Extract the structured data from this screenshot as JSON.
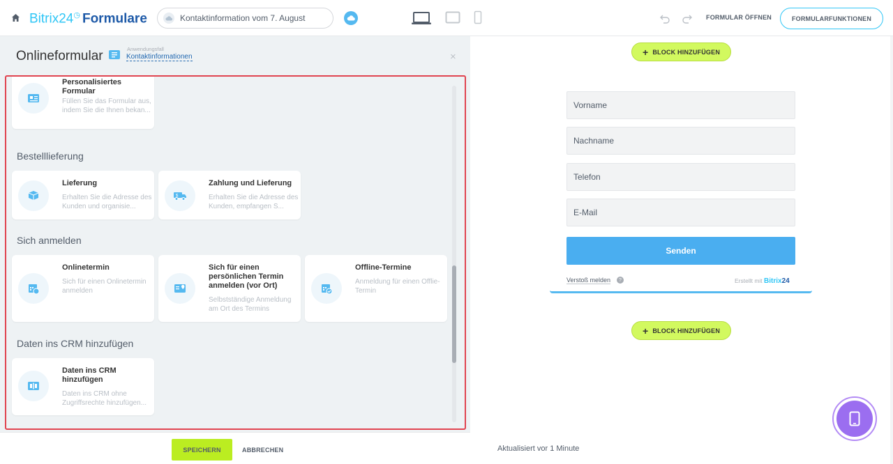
{
  "header": {
    "brand_part1": "Bitrix24",
    "brand_clock": "◷",
    "brand_part2": "Formulare",
    "form_title": "Kontaktinformation vom 7. August",
    "open_form": "FORMULAR ÖFFNEN",
    "form_functions": "FORMULARFUNKTIONEN"
  },
  "left": {
    "title": "Onlineformular",
    "usecase_label": "Anwendungsfall",
    "usecase_value": "Kontaktinformationen",
    "close": "×",
    "cards": [
      {
        "title": "Personalisiertes Formular",
        "desc": "Füllen Sie das Formular aus, indem Sie die Ihnen bekan..."
      },
      {
        "title": "Lieferung",
        "desc": "Erhalten Sie die Adresse des Kunden und organisie..."
      },
      {
        "title": "Zahlung und Lieferung",
        "desc": "Erhalten Sie die Adresse des Kunden, empfangen S..."
      },
      {
        "title": "Onlinetermin",
        "desc": "Sich für einen Onlinetermin anmelden"
      },
      {
        "title": "Sich für einen persönlichen Termin anmelden (vor Ort)",
        "desc": "Selbstständige Anmeldung am Ort des Termins"
      },
      {
        "title": "Offline-Termine",
        "desc": "Anmeldung für einen Offlie-Termin"
      },
      {
        "title": "Daten ins CRM hinzufügen",
        "desc": "Daten ins CRM ohne Zugriffsrechte hinzufügen..."
      }
    ],
    "sections": [
      "Bestelllieferung",
      "Sich anmelden",
      "Daten ins CRM hinzufügen"
    ],
    "save": "SPEICHERN",
    "cancel": "ABBRECHEN"
  },
  "right": {
    "add_block": "BLOCK HINZUFÜGEN",
    "fields": [
      "Vorname",
      "Nachname",
      "Telefon",
      "E-Mail"
    ],
    "send": "Senden",
    "report": "Verstoß melden",
    "help": "?",
    "made_with": "Erstellt mit",
    "made_brand1": "Bitrix",
    "made_brand2": "24",
    "updated": "Aktualisiert vor 1 Minute"
  },
  "colors": {
    "accent": "#2fc6f6",
    "brand_dark": "#1e5aa8",
    "save": "#bbed21",
    "add_block": "#d2f95f",
    "send": "#4aaef0",
    "highlight": "#e0434f",
    "mobile": "#9b6ef0"
  }
}
